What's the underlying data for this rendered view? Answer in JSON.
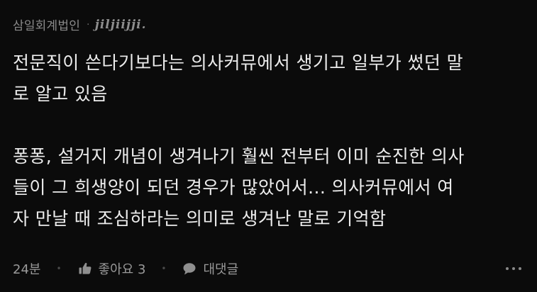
{
  "comment": {
    "company": "삼일회계법인",
    "separator": "·",
    "nickname": "jiljiijji.",
    "paragraph1": [
      "전문직이 쓴다기보다는 의사커뮤에서 생기고 일부가 썼던 말",
      "로 알고 있음"
    ],
    "paragraph2": [
      "퐁퐁, 설거지 개념이 생겨나기 훨씬 전부터 이미 순진한 의사",
      "들이 그 희생양이 되던 경우가 많았어서... 의사커뮤에서 여",
      "자 만날 때 조심하라는 의미로 생겨난 말로 기억함"
    ]
  },
  "actions": {
    "time": "24분",
    "like_label": "좋아요 3",
    "reply_label": "대댓글",
    "like_icon": "thumbs-up-icon",
    "reply_icon": "speech-bubble-icon",
    "more_icon": "more-dots-icon"
  }
}
